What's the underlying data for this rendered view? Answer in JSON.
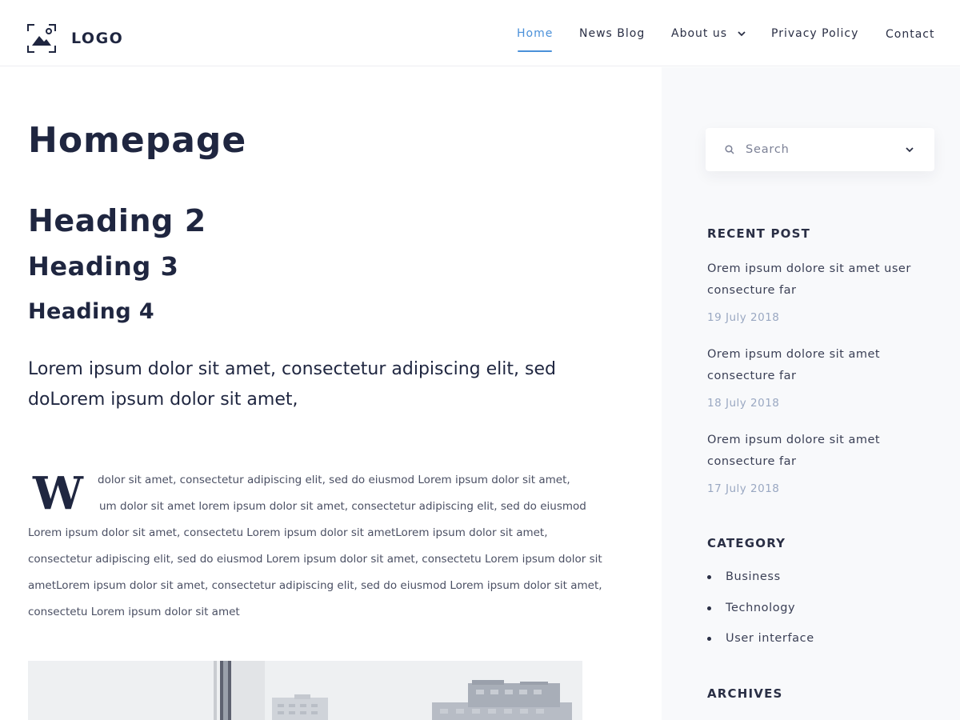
{
  "header": {
    "logo_text": "LOGO",
    "nav": [
      {
        "label": "Home",
        "active": true
      },
      {
        "label": "News Blog"
      },
      {
        "label": "About us",
        "has_dropdown": true
      },
      {
        "label": "Privacy Policy"
      },
      {
        "label": "Contact"
      }
    ]
  },
  "main": {
    "title": "Homepage",
    "h2": "Heading 2",
    "h3": "Heading 3",
    "h4": "Heading 4",
    "lead": "Lorem ipsum dolor sit amet, consectetur adipiscing elit, sed doLorem ipsum dolor sit amet,",
    "dropcap": "W",
    "body_lines": [
      "dolor sit amet, consectetur adipiscing elit, sed do eiusmod Lorem ipsum dolor sit amet,",
      "um dolor sit amet lorem ipsum dolor sit amet, consectetur adipiscing elit, sed do eiusmod",
      "Lorem ipsum dolor sit amet, consectetu  Lorem ipsum dolor sit ametLorem ipsum dolor sit amet,",
      "consectetur adipiscing elit, sed do eiusmod Lorem ipsum dolor sit amet, consectetu  Lorem ipsum dolor sit",
      "ametLorem ipsum dolor sit amet, consectetur adipiscing elit, sed do eiusmod Lorem ipsum dolor sit amet,",
      "consectetu  Lorem ipsum dolor sit amet"
    ]
  },
  "sidebar": {
    "search_placeholder": "Search",
    "recent_title": "RECENT POST",
    "posts": [
      {
        "title": "Orem ipsum dolore sit amet user consecture far",
        "date": "19 July 2018"
      },
      {
        "title": "Orem ipsum dolore sit amet consecture far",
        "date": "18 July 2018"
      },
      {
        "title": "Orem ipsum dolore sit amet consecture far",
        "date": "17 July 2018"
      }
    ],
    "category_title": "CATEGORY",
    "categories": [
      "Business",
      "Technology",
      "User interface"
    ],
    "archives_title": "ARCHIVES"
  },
  "colors": {
    "accent": "#4a90d9",
    "heading": "#1f2640",
    "sidebar_bg": "#f8f9fb",
    "date": "#9aa8c2"
  },
  "icons": {
    "logo": "image-frame-icon",
    "dropdown": "chevron-down-icon",
    "search": "search-icon"
  }
}
